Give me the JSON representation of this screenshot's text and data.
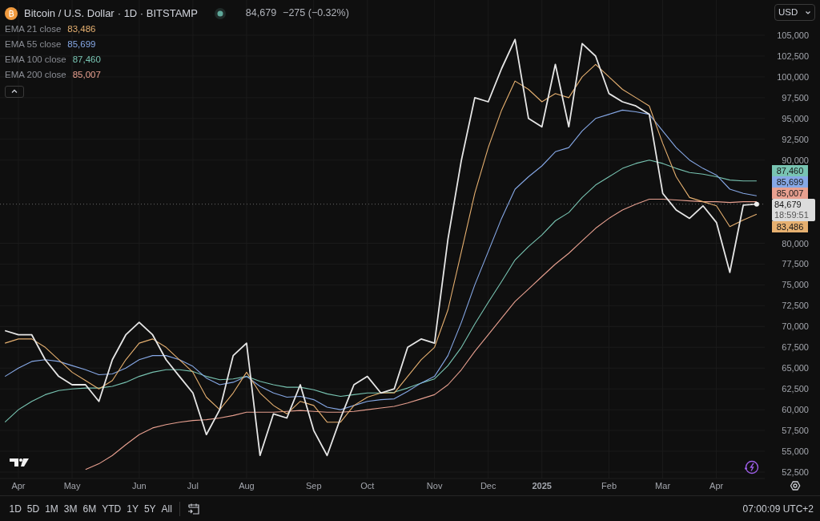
{
  "legend": {
    "title_rest": "· 1D · BITSTAMP",
    "price": "84,679",
    "change": "−275 (−0.32%)",
    "indicator_values": [
      "83,486",
      "85,699",
      "87,460",
      "85,007"
    ]
  },
  "currency": "USD",
  "chart_data": {
    "type": "line",
    "grid": true,
    "ylim": [
      51725,
      109239
    ],
    "ref_lines": [
      {
        "axis": "y",
        "value": 84700
      }
    ],
    "yticks": [
      {
        "value": 52500,
        "label": "52,500"
      },
      {
        "value": 55000,
        "label": "55,000"
      },
      {
        "value": 57500,
        "label": "57,500"
      },
      {
        "value": 60000,
        "label": "60,000"
      },
      {
        "value": 62500,
        "label": "62,500"
      },
      {
        "value": 65000,
        "label": "65,000"
      },
      {
        "value": 67500,
        "label": "67,500"
      },
      {
        "value": 70000,
        "label": "70,000"
      },
      {
        "value": 72500,
        "label": "72,500"
      },
      {
        "value": 75000,
        "label": "75,000"
      },
      {
        "value": 77500,
        "label": "77,500"
      },
      {
        "value": 80000,
        "label": "80,000"
      },
      {
        "value": 90000,
        "label": "90,000"
      },
      {
        "value": 92500,
        "label": "92,500"
      },
      {
        "value": 95000,
        "label": "95,000"
      },
      {
        "value": 97500,
        "label": "97,500"
      },
      {
        "value": 100000,
        "label": "100,000"
      },
      {
        "value": 102500,
        "label": "102,500"
      },
      {
        "value": 105000,
        "label": "105,000"
      }
    ],
    "categories": [
      null,
      "Apr",
      null,
      null,
      null,
      "May",
      null,
      null,
      null,
      null,
      "Jun",
      null,
      null,
      null,
      "Jul",
      null,
      null,
      null,
      "Aug",
      null,
      null,
      null,
      null,
      "Sep",
      null,
      null,
      null,
      "Oct",
      null,
      null,
      null,
      null,
      "Nov",
      null,
      null,
      null,
      "Dec",
      null,
      null,
      null,
      "2025",
      null,
      null,
      null,
      null,
      "Feb",
      null,
      null,
      null,
      "Mar",
      null,
      null,
      null,
      "Apr",
      null,
      null,
      null
    ],
    "series": [
      {
        "name": "Bitcoin / U.S. Dollar",
        "color": "#e6e6e6",
        "values": [
          69500,
          69000,
          69000,
          66000,
          64000,
          63000,
          63000,
          61000,
          66000,
          69000,
          70500,
          69000,
          66000,
          64000,
          62000,
          57000,
          60000,
          66500,
          68000,
          54500,
          59500,
          59000,
          63000,
          57500,
          54500,
          59000,
          63000,
          64000,
          62000,
          62500,
          67500,
          68500,
          68000,
          80500,
          90000,
          97500,
          97000,
          101000,
          104500,
          95000,
          94000,
          101500,
          94000,
          104000,
          102500,
          98000,
          97000,
          96500,
          95500,
          86000,
          84000,
          83000,
          84500,
          82500,
          76500,
          84600,
          84700
        ]
      },
      {
        "name": "EMA 21 close",
        "color": "#e6b070",
        "values": [
          68000,
          68500,
          68500,
          67500,
          66000,
          64500,
          63500,
          62500,
          63500,
          66000,
          68000,
          68500,
          67500,
          66000,
          64500,
          61500,
          60000,
          62000,
          64500,
          62000,
          60500,
          59500,
          61000,
          60500,
          58500,
          58500,
          60500,
          61500,
          62000,
          62000,
          64000,
          66000,
          67500,
          72000,
          79000,
          86000,
          91500,
          96000,
          99500,
          98500,
          97000,
          98000,
          97500,
          100000,
          101500,
          100000,
          98500,
          97500,
          96500,
          92000,
          88000,
          85500,
          85000,
          84500,
          82000,
          82800,
          83500
        ]
      },
      {
        "name": "EMA 55 close",
        "color": "#86a8e6",
        "values": [
          64000,
          65000,
          65800,
          66000,
          65800,
          65300,
          64800,
          64200,
          64300,
          65000,
          66000,
          66500,
          66500,
          66000,
          65200,
          63800,
          63000,
          63300,
          64000,
          62800,
          62000,
          61500,
          61600,
          61200,
          60300,
          60000,
          60500,
          61000,
          61200,
          61300,
          62200,
          63200,
          64000,
          66500,
          70500,
          75000,
          79000,
          83000,
          86500,
          88000,
          89300,
          91000,
          91500,
          93500,
          95000,
          95500,
          96000,
          95800,
          95500,
          93500,
          91500,
          90000,
          89000,
          88200,
          86500,
          86000,
          85700
        ]
      },
      {
        "name": "EMA 100 close",
        "color": "#78c4b2",
        "values": [
          58500,
          60000,
          61000,
          61800,
          62300,
          62500,
          62600,
          62600,
          62800,
          63300,
          64000,
          64500,
          64800,
          64800,
          64600,
          64000,
          63600,
          63700,
          64000,
          63400,
          63000,
          62700,
          62700,
          62400,
          61900,
          61600,
          61800,
          62000,
          62000,
          62100,
          62600,
          63200,
          63700,
          65300,
          67500,
          70300,
          72900,
          75400,
          78000,
          79600,
          81000,
          82700,
          83700,
          85500,
          87000,
          88000,
          89000,
          89600,
          90000,
          89600,
          89000,
          88500,
          88300,
          88000,
          87600,
          87500,
          87500
        ]
      },
      {
        "name": "EMA 200 close",
        "color": "#e8a090",
        "values": [
          null,
          null,
          null,
          null,
          null,
          null,
          52800,
          53500,
          54500,
          55800,
          57000,
          57800,
          58200,
          58500,
          58700,
          58800,
          59000,
          59300,
          59700,
          59700,
          59700,
          59800,
          59900,
          59800,
          59700,
          59700,
          59800,
          60000,
          60200,
          60400,
          60800,
          61300,
          61800,
          63000,
          64800,
          67000,
          69000,
          71000,
          73000,
          74500,
          76000,
          77500,
          78800,
          80300,
          81800,
          83000,
          84000,
          84700,
          85300,
          85300,
          85200,
          85100,
          85000,
          85000,
          84900,
          85000,
          85000
        ]
      }
    ]
  },
  "price_tags": [
    {
      "kind": "indicator",
      "text": "87,460",
      "color": "#78c4b2"
    },
    {
      "kind": "indicator",
      "text": "85,699",
      "color": "#86a8e6"
    },
    {
      "kind": "indicator",
      "text": "85,007",
      "color": "#e8a090"
    },
    {
      "kind": "last",
      "text": "84,679",
      "time": "18:59:51"
    },
    {
      "kind": "indicator",
      "text": "83,486",
      "color": "#e6b070"
    }
  ],
  "ranges": [
    "1D",
    "5D",
    "1M",
    "3M",
    "6M",
    "YTD",
    "1Y",
    "5Y",
    "All"
  ],
  "clock": "07:00:09 UTC+2"
}
